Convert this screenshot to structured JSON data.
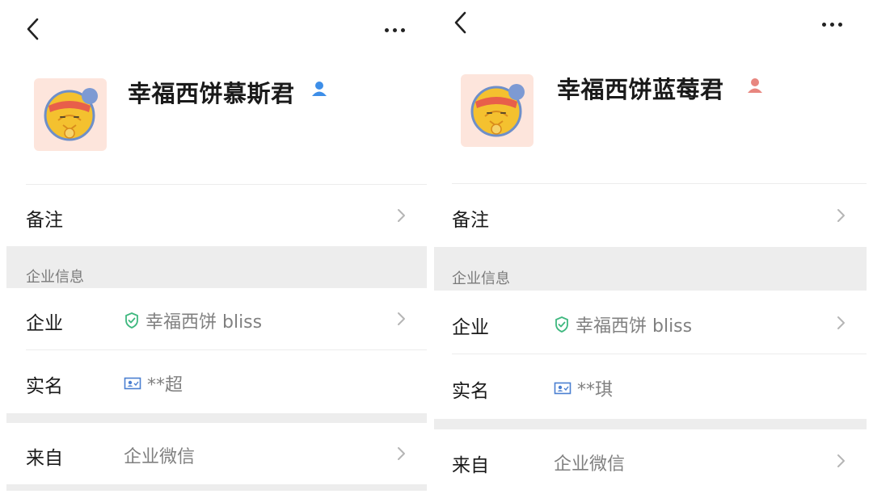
{
  "profiles": [
    {
      "name": "幸福西饼慕斯君",
      "gender_icon": "male-user-icon",
      "gender_color": "#3d8ee8",
      "remark_label": "备注",
      "section_title": "企业信息",
      "company_label": "企业",
      "company_value": "幸福西饼 bliss",
      "realname_label": "实名",
      "realname_value": "**超",
      "source_label": "来自",
      "source_value": "企业微信"
    },
    {
      "name": "幸福西饼蓝莓君",
      "gender_icon": "female-user-icon",
      "gender_color": "#e8867f",
      "remark_label": "备注",
      "section_title": "企业信息",
      "company_label": "企业",
      "company_value": "幸福西饼 bliss",
      "realname_label": "实名",
      "realname_value": "**琪",
      "source_label": "来自",
      "source_value": "企业微信"
    }
  ],
  "colors": {
    "verified_green": "#3fb87f",
    "id_blue": "#4a7fd1",
    "section_gray": "#ededed",
    "avatar_bg": "#fde5dc"
  }
}
